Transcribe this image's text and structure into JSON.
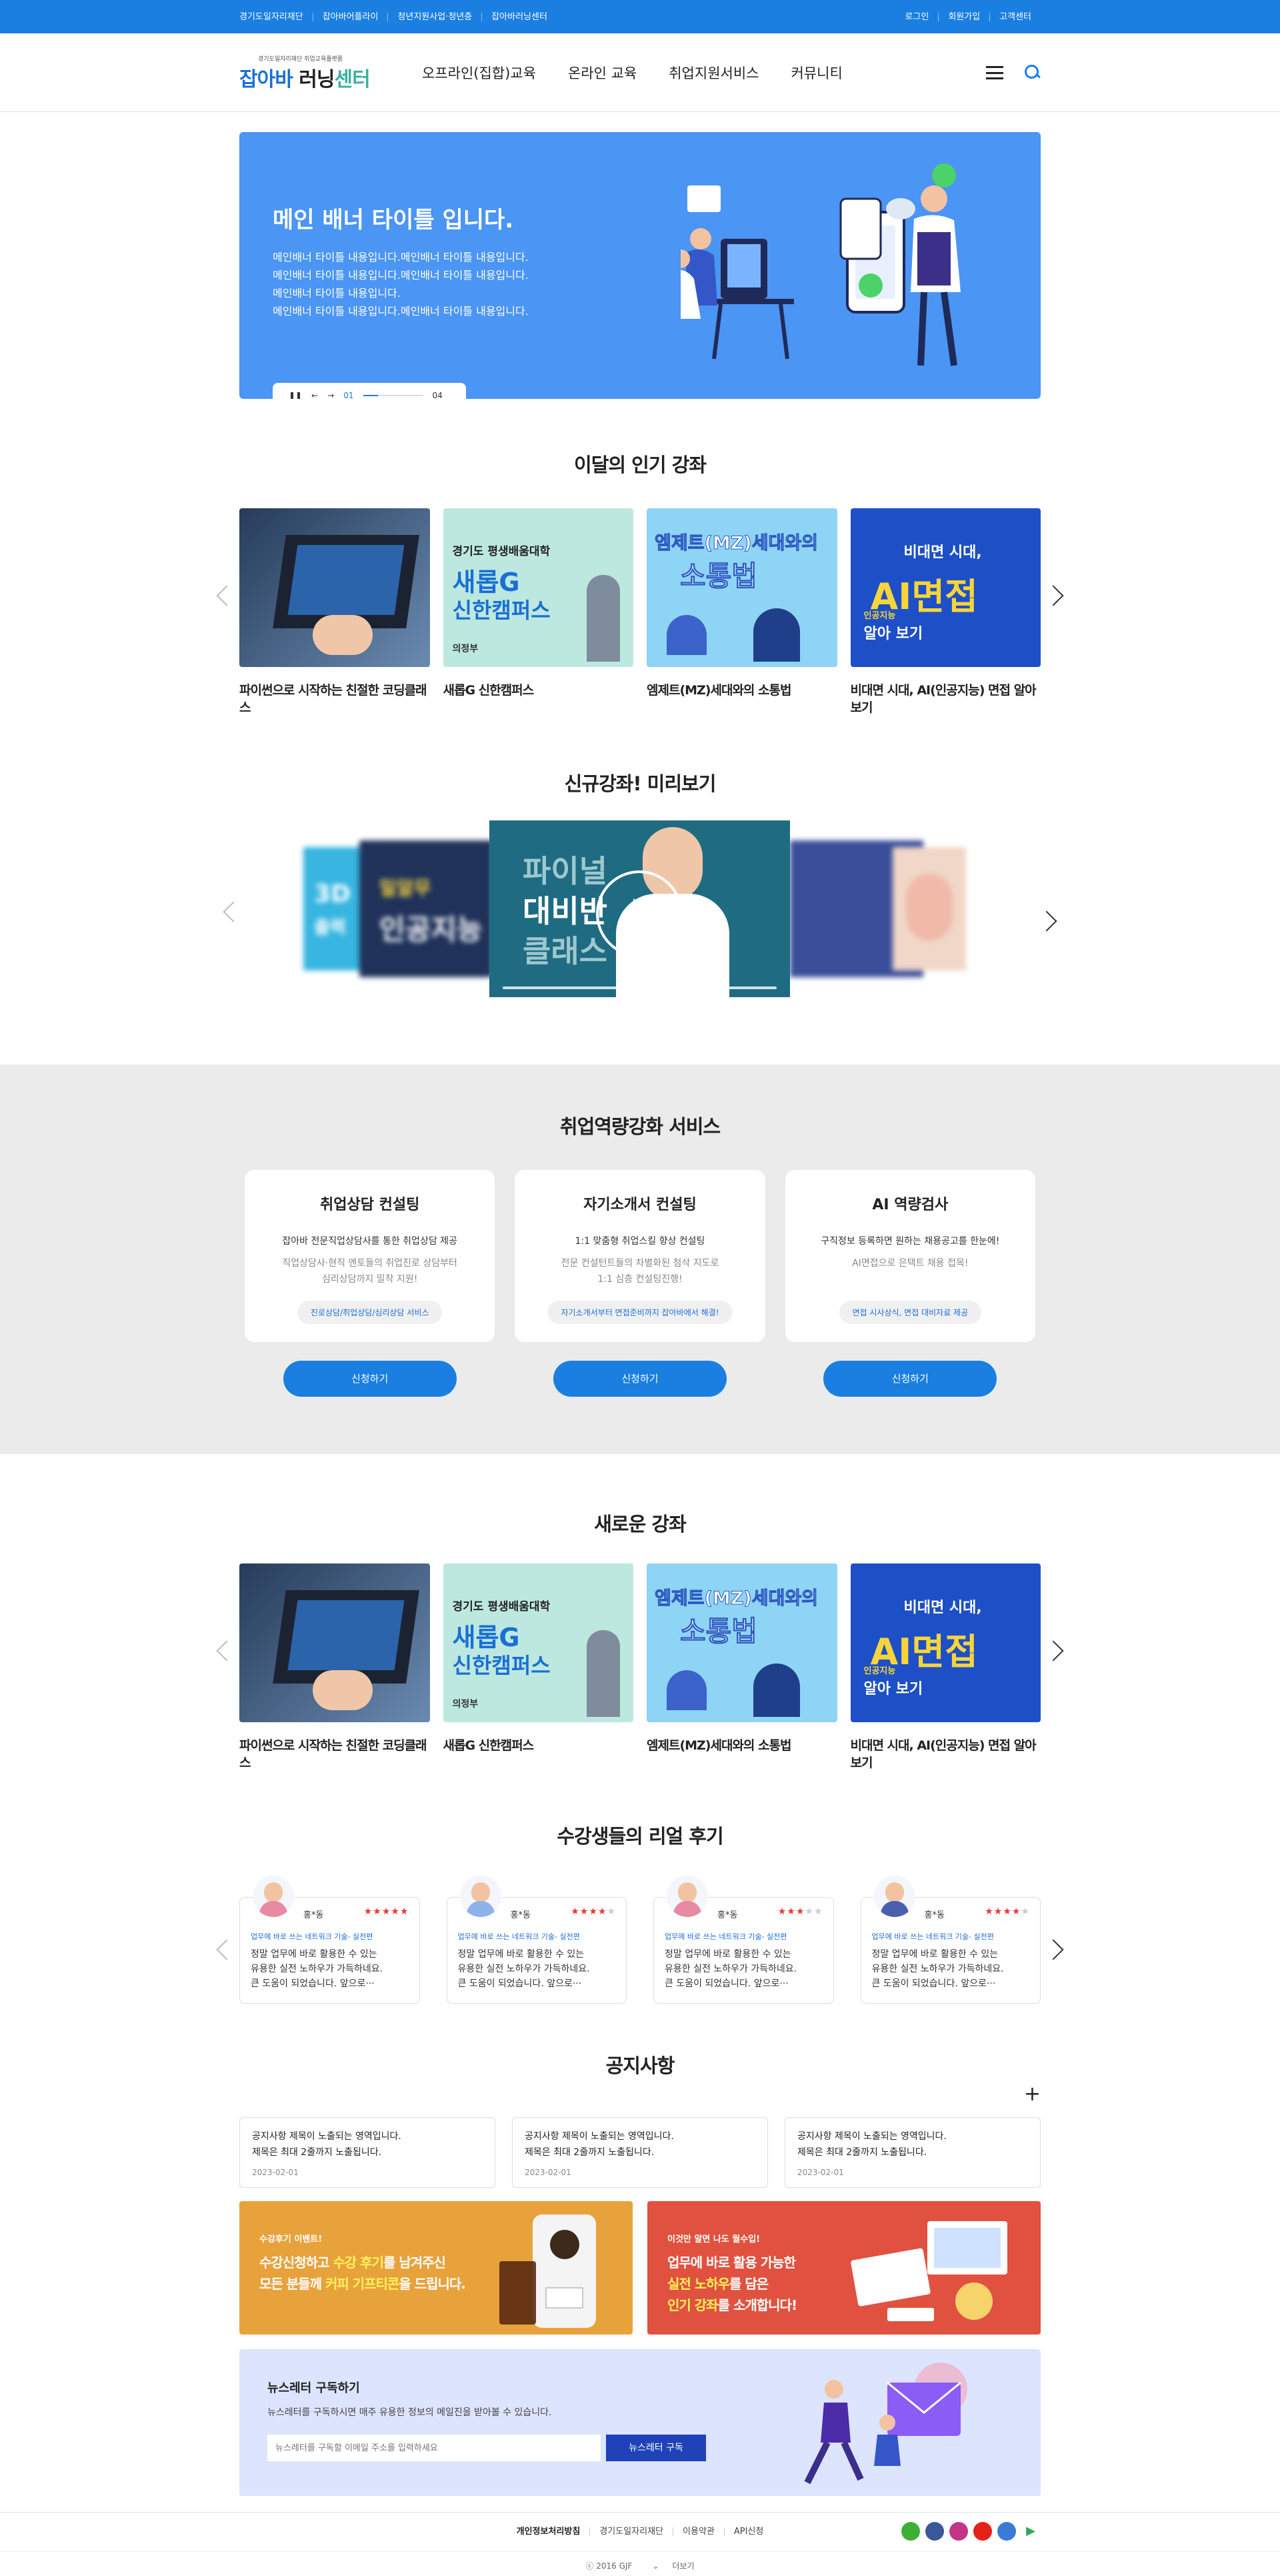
{
  "topbar": {
    "links": [
      "경기도일자리재단",
      "잡아바어플라이",
      "청년지원사업·청년층",
      "잡아바러닝센터"
    ],
    "right": [
      "로그인",
      "회원가입",
      "고객센터"
    ]
  },
  "header": {
    "logo_sub": "경기도일자리재단 취업교육플랫폼",
    "logo_a": "잡아바",
    "logo_b": " 러닝",
    "logo_c": "센터",
    "nav": [
      "오프라인(집합)교육",
      "온라인 교육",
      "취업지원서비스",
      "커뮤니티"
    ]
  },
  "banner": {
    "title": "메인 배너 타이틀 입니다.",
    "lines": [
      "메인배너 타이틀 내용입니다.메인배너 타이틀 내용입니다.",
      "메인배너 타이틀 내용입니다.메인배너 타이틀 내용입니다.",
      "메인배너 타이틀 내용입니다.",
      "메인배너 타이틀 내용입니다.메인배너 타이틀 내용입니다."
    ],
    "current": "01",
    "total": "04",
    "progress": 0.25
  },
  "popular": {
    "title": "이달의 인기 강좌",
    "items": [
      {
        "title": "파이썬으로 시작하는 친절한 코딩클래스",
        "thumb_text": []
      },
      {
        "title": "새롭G 신한캠퍼스",
        "thumb_text": [
          "경기도 평생배움대학",
          "새롭G",
          "신한캠퍼스",
          "의정부"
        ]
      },
      {
        "title": "엠제트(MZ)세대와의 소통법",
        "thumb_text": [
          "엠제트(MZ)세대와의",
          "소통법"
        ]
      },
      {
        "title": "비대면 시대, AI(인공지능) 면접 알아보기",
        "thumb_text": [
          "비대면 시대,",
          "AI면접",
          "인공지능",
          "알아 보기"
        ]
      }
    ]
  },
  "preview": {
    "title": "신규강좌! 미리보기",
    "main_text": [
      "파이널",
      "대비반",
      "클래스"
    ],
    "side_left": [
      "3D",
      "출력"
    ],
    "side_left2": [
      "밀알무",
      "인공지능"
    ]
  },
  "services": {
    "title": "취업역량강화 서비스",
    "items": [
      {
        "name": "취업상담 컨설팅",
        "l1": "잡아바 전문직업상담사를 통한 취업상담 제공",
        "l2": [
          "직업상담사·현직 멘토들의 취업진로 상담부터",
          "심리상담까지 밀착 지원!"
        ],
        "tag": "진로상담/취업상담/심리상담 서비스",
        "btn": "신청하기"
      },
      {
        "name": "자기소개서 컨설팅",
        "l1": "1:1 맞춤형 취업스킬 향상 컨설팅",
        "l2": [
          "전문 컨설턴트들의 차별화된 첨삭 지도로",
          "1:1 심층 컨설팅진행!"
        ],
        "tag": "자기소개서부터 면접준비까지 잡아바에서 해결!",
        "btn": "신청하기"
      },
      {
        "name": "AI 역량검사",
        "l1": "구직정보 등록하면 원하는 채용공고를 한눈에!",
        "l2": [
          "AI면접으로 은택트 채용 접목!"
        ],
        "tag": "면접 시사상식, 면접 대비자료 제공",
        "btn": "신청하기"
      }
    ]
  },
  "newcourses": {
    "title": "새로운 강좌"
  },
  "reviews": {
    "title": "수강생들의 리얼 후기",
    "items": [
      {
        "name": "홍*동",
        "stars": 5,
        "kw": "업무에 바로 쓰는 네트워크 기술- 실전편",
        "text": [
          "정말 업무에 바로 활용한 수 있는",
          "유용한 실전 노하우가 가득하네요.",
          "큰 도움이 되었습니다. 앞으로···"
        ]
      },
      {
        "name": "홍*동",
        "stars": 4,
        "kw": "업무에 바로 쓰는 네트워크 기술- 실전편",
        "text": [
          "정말 업무에 바로 활용한 수 있는",
          "유용한 실전 노하우가 가득하네요.",
          "큰 도움이 되었습니다. 앞으로···"
        ]
      },
      {
        "name": "홍*동",
        "stars": 3,
        "kw": "업무에 바로 쓰는 네트워크 기술- 실전편",
        "text": [
          "정말 업무에 바로 활용한 수 있는",
          "유용한 실전 노하우가 가득하네요.",
          "큰 도움이 되었습니다. 앞으로···"
        ]
      },
      {
        "name": "홍*동",
        "stars": 4,
        "kw": "업무에 바로 쓰는 네트워크 기술- 실전편",
        "text": [
          "정말 업무에 바로 활용한 수 있는",
          "유용한 실전 노하우가 가득하네요.",
          "큰 도움이 되었습니다. 앞으로···"
        ]
      }
    ]
  },
  "notice": {
    "title": "공지사항",
    "more": "+",
    "items": [
      {
        "l1": "공지사항 제목이 노출되는 영역입니다.",
        "l2": "제목은 최대 2줄까지 노출됩니다.",
        "date": "2023-02-01"
      },
      {
        "l1": "공지사항 제목이 노출되는 영역입니다.",
        "l2": "제목은 최대 2줄까지 노출됩니다.",
        "date": "2023-02-01"
      },
      {
        "l1": "공지사항 제목이 노출되는 영역입니다.",
        "l2": "제목은 최대 2줄까지 노출됩니다.",
        "date": "2023-02-01"
      }
    ]
  },
  "promo": [
    {
      "small": "수강후기 이벤트!",
      "l1a": "수강신청하고 ",
      "l1b": "수강 후기",
      "l1c": "를 남겨주신",
      "l2a": "모든 분들께 ",
      "l2b": "커피 기프티콘",
      "l2c": "을 드립니다.",
      "color": "#e8a23c"
    },
    {
      "small": "이것만 알면 나도 월수입!",
      "l1a": "업무에 바로 활용 가능한",
      "l1b": "",
      "l1c": "",
      "l2a": "",
      "l2b": "실전 노하우",
      "l2c": "를 담은",
      "l3b": "인기 강좌",
      "l3c": "를 소개합니다!",
      "color": "#e0523f"
    }
  ],
  "newsletter": {
    "title": "뉴스레터 구독하기",
    "desc": "뉴스레터를 구독하시면 매주 유용한 정보의 메일진을 받아볼 수 있습니다.",
    "placeholder": "뉴스레터를 구독할 이메일 주소를 입력하세요",
    "btn": "뉴스레터 구독"
  },
  "footer": {
    "links": [
      "개인정보처리방침",
      "경기도일자리재단",
      "이용약관",
      "API신청"
    ],
    "copy": "ⓒ 2016 GJF",
    "more": "더보기"
  }
}
